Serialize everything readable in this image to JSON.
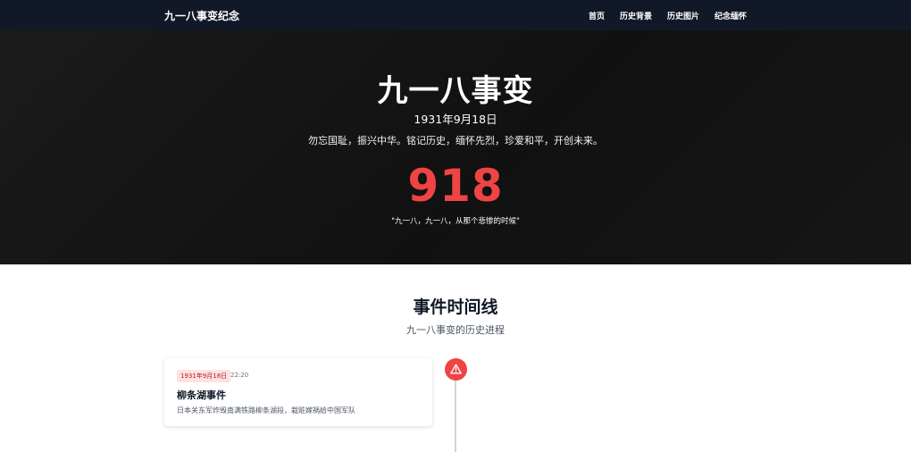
{
  "nav": {
    "brand": "九一八事变纪念",
    "links": [
      "首页",
      "历史背景",
      "历史图片",
      "纪念缅怀"
    ]
  },
  "hero": {
    "title": "九一八事变",
    "date": "1931年9月18日",
    "slogan": "勿忘国耻，振兴中华。铭记历史，缅怀先烈，珍爱和平，开创未来。",
    "number": "918",
    "quote": "\"九一八，九一八，从那个悲惨的时候\""
  },
  "timeline": {
    "title": "事件时间线",
    "subtitle": "九一八事变的历史进程",
    "events": [
      {
        "date": "1931年9月18日",
        "time": "22:20",
        "title": "柳条湖事件",
        "description": "日本关东军炸毁南满铁路柳条湖段，栽赃嫁祸给中国军队",
        "icon": "warning-icon"
      }
    ]
  },
  "colors": {
    "nav_bg": "#111827",
    "hero_bg": "#151515",
    "accent_red": "#ef4444",
    "badge_bg": "#fee2e2",
    "badge_text": "#b91c1c"
  }
}
